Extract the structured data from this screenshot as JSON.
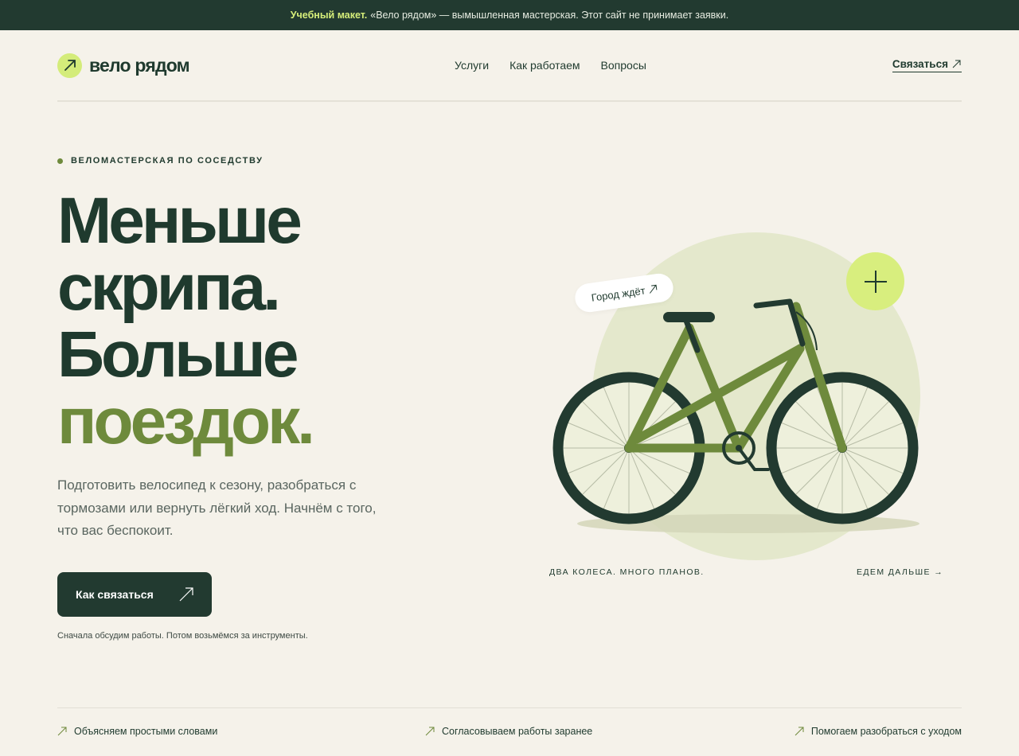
{
  "topbar": {
    "label": "Учебный макет.",
    "text": "«Вело рядом» — вымышленная мастерская. Этот сайт не принимает заявки."
  },
  "header": {
    "logo_text": "вело рядом",
    "nav": [
      "Услуги",
      "Как работаем",
      "Вопросы"
    ],
    "contact_label": "Связаться",
    "contact_icon": "arrow-up-right-icon"
  },
  "hero": {
    "eyebrow": "ВЕЛОМАСТЕРСКАЯ ПО СОСЕДСТВУ",
    "headline_lines": [
      "Меньше",
      "скрипа.",
      "Больше"
    ],
    "headline_accent": "поездок.",
    "lead": "Подготовить велосипед к сезону, разобраться с тормозами или вернуть лёгкий ход. Начнём с того, что вас беспокоит.",
    "cta_label": "Как связаться",
    "cta_note": "Сначала обсудим работы. Потом возьмёмся за инструменты."
  },
  "illustration": {
    "pill_text": "Город ждёт",
    "caption_left": "ДВА КОЛЕСА. МНОГО ПЛАНОВ.",
    "caption_right": "ЕДЕМ ДАЛЬШЕ →",
    "plus_icon": "plus-icon",
    "colors": {
      "frame": "#6e8a3c",
      "dark": "#223a30",
      "circle": "#e4e8cc",
      "accent": "#d8ee7e"
    }
  },
  "features": [
    "Объясняем простыми словами",
    "Согласовываем работы заранее",
    "Помогаем разобраться с уходом"
  ]
}
